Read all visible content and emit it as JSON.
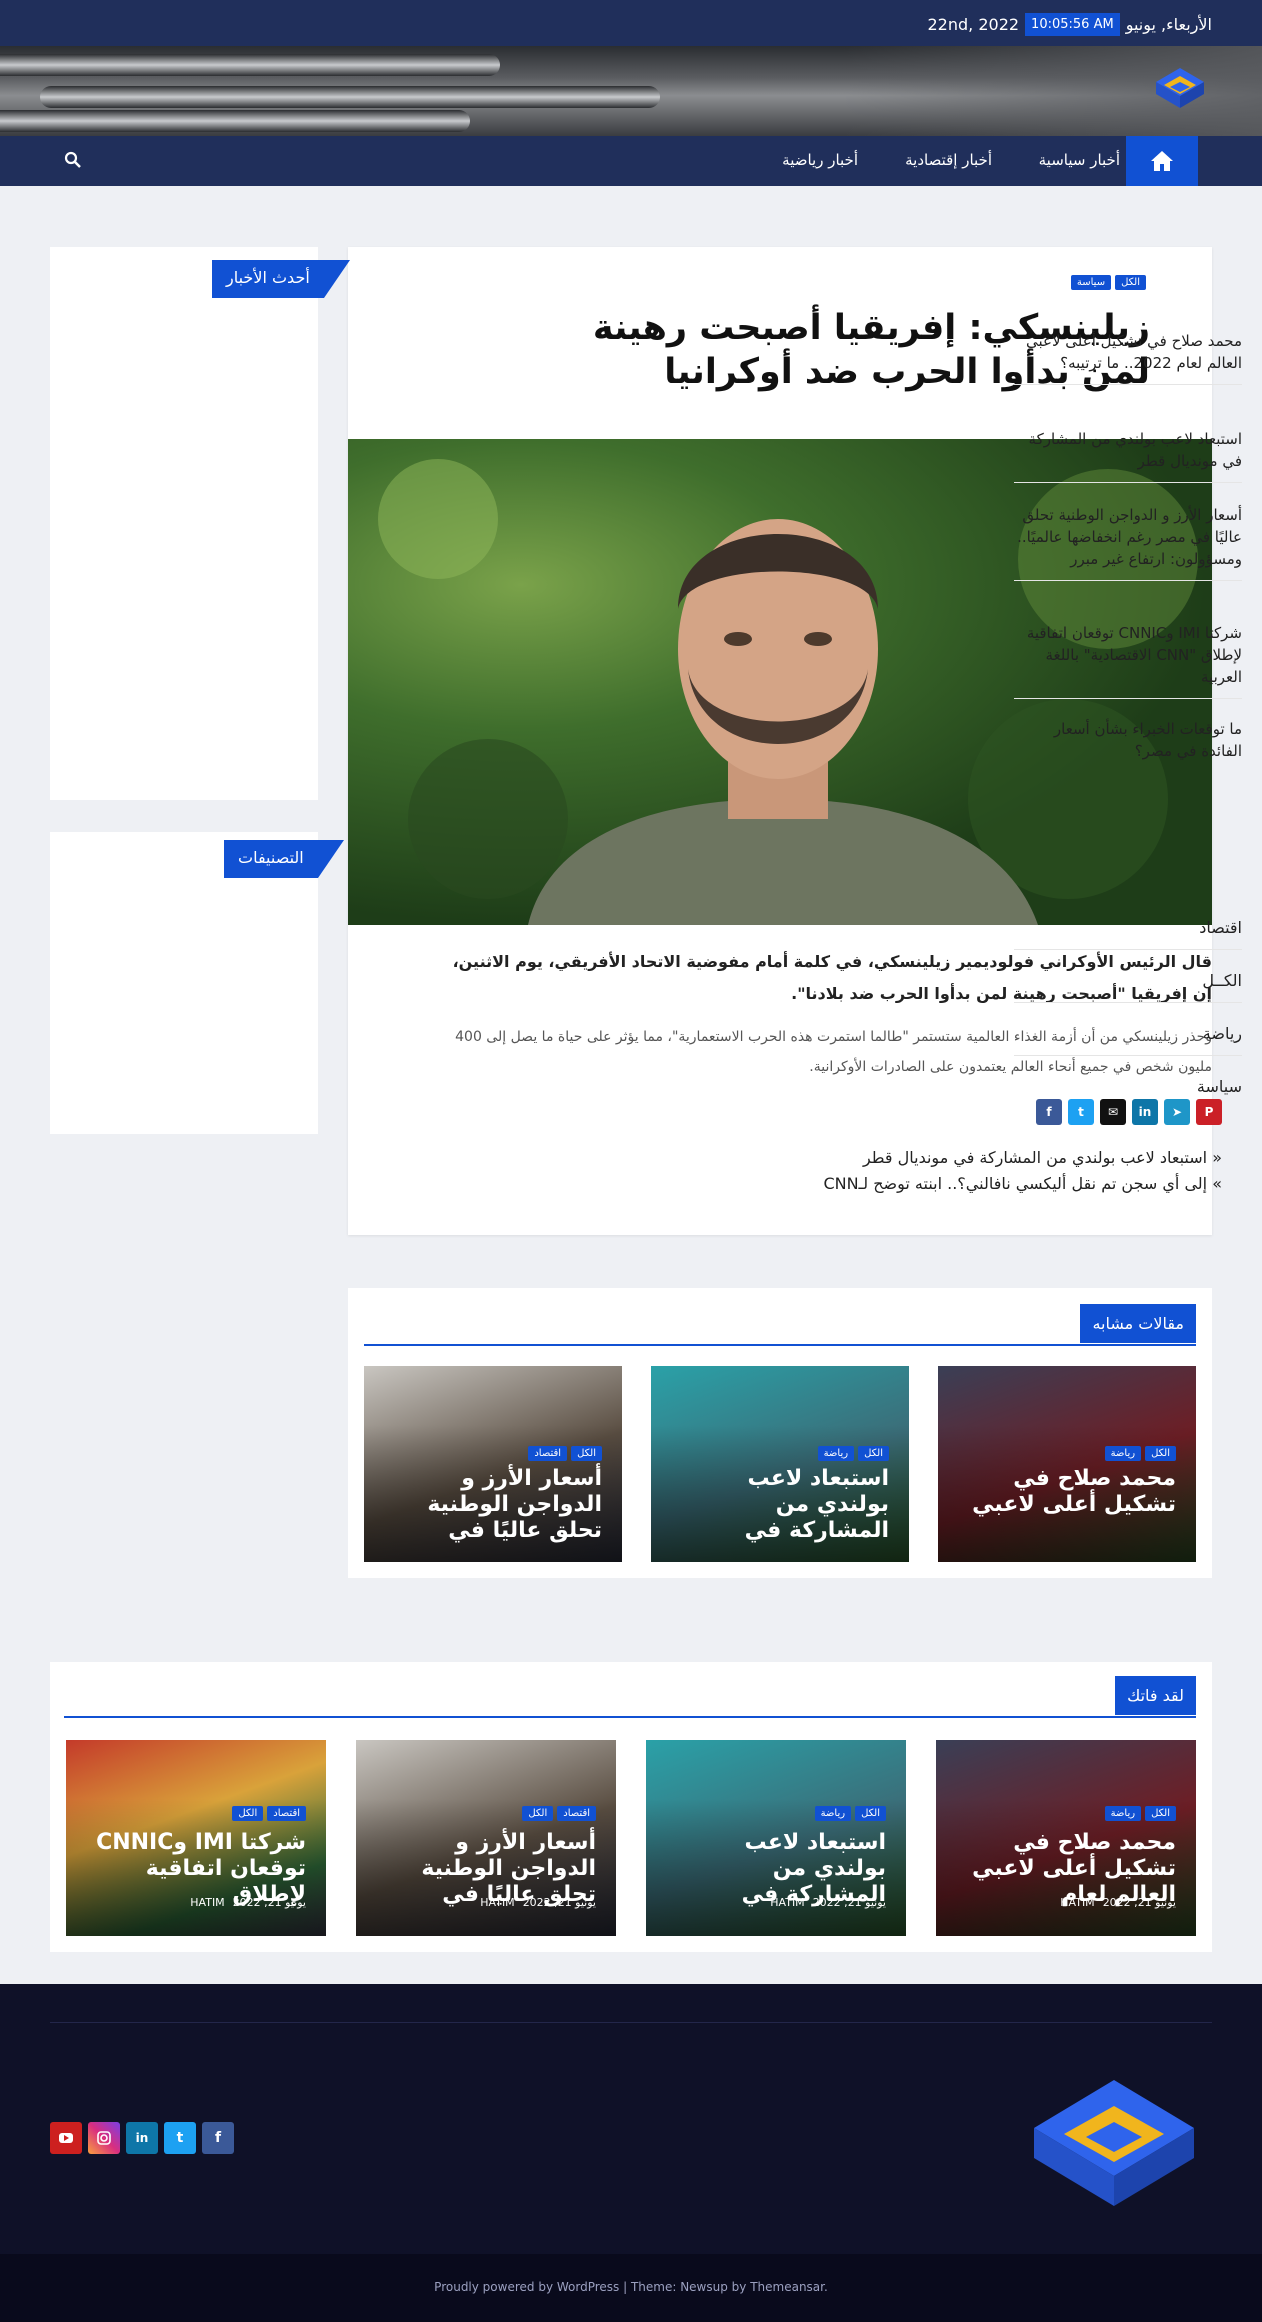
{
  "topbar": {
    "day_label": "الأربعاء, يونيو",
    "time": "10:05:56 AM",
    "date_tail": "22nd, 2022"
  },
  "nav": {
    "items": [
      "أخبار سياسية",
      "أخبار إقتصادية",
      "أخبار رياضية"
    ]
  },
  "article": {
    "categories": [
      "الكل",
      "سياسة"
    ],
    "title": "زيلينسكي: إفريقيا أصبحت رهينة لمن بدأوا الحرب ضد أوكرانيا",
    "lead": "قال الرئيس الأوكراني فولوديمير زيلينسكي، في كلمة أمام مفوضية الاتحاد الأفريقي، يوم الاثنين، إن إفريقيا \"أصبحت رهينة لمن بدأوا الحرب ضد بلادنا\".",
    "body": "وحذر زيلينسكي من أن أزمة الغذاء العالمية ستستمر \"طالما استمرت هذه الحرب الاستعمارية\"، مما يؤثر على حياة ما يصل إلى 400 مليون شخص في جميع أنحاء العالم يعتمدون على الصادرات الأوكرانية.",
    "share_icons": [
      "facebook-icon",
      "twitter-icon",
      "email-icon",
      "linkedin-icon",
      "telegram-icon",
      "pinterest-icon"
    ],
    "prev_post": "استبعاد لاعب بولندي من المشاركة في مونديال قطر",
    "next_post": "إلى أي سجن تم نقل أليكسي نافالني؟.. ابنته توضح لـCNN"
  },
  "sidebar": {
    "latest_title": "أحدث الأخبار",
    "latest": [
      "محمد صلاح في تشكيل أعلى لاعبي العالم لعام 2022.. ما ترتيبه؟",
      "استبعاد لاعب بولندي من المشاركة في مونديال قطر",
      "أسعار الأرز و الدواجن الوطنية تحلق عاليًا في مصر رغم انخفاضها عالميًا.. ومسؤولون: ارتفاع غير مبرر",
      "شركتا IMI وCNNIC توقعان اتفاقية لإطلاق \"CNN الاقتصادية\" باللغة العربية",
      "ما توقعات الخبراء بشأن أسعار الفائدة في مصر؟"
    ],
    "categories_title": "التصنيفات",
    "categories": [
      "اقتصاد",
      "الكــل",
      "رياضة",
      "سياسة"
    ]
  },
  "related": {
    "title": "مقالات مشابه",
    "cards": [
      {
        "title": "محمد صلاح في تشكيل أعلى لاعبي",
        "badges": [
          "الكل",
          "رياضة"
        ]
      },
      {
        "title": "استبعاد لاعب بولندي من المشاركة في",
        "badges": [
          "الكل",
          "رياضة"
        ]
      },
      {
        "title": "أسعار الأرز و الدواجن الوطنية تحلق عاليًا في",
        "badges": [
          "الكل",
          "اقتصاد"
        ]
      }
    ]
  },
  "missed": {
    "title": "لقد فاتك",
    "cards": [
      {
        "title": "محمد صلاح في تشكيل أعلى لاعبي العالم لعام",
        "badges": [
          "الكل",
          "رياضة"
        ],
        "date": "يونيو 21, 2022",
        "author": "HATIM"
      },
      {
        "title": "استبعاد لاعب بولندي من المشاركة في",
        "badges": [
          "الكل",
          "رياضة"
        ],
        "date": "يونيو 21, 2022",
        "author": "HATIM"
      },
      {
        "title": "أسعار الأرز و الدواجن الوطنية تحلق عاليًا في",
        "badges": [
          "اقتصاد",
          "الكل"
        ],
        "date": "يونيو 21, 2022",
        "author": "HATIM"
      },
      {
        "title": "شركتا IMI وCNNIC توقعان اتفاقية لإطلاق",
        "badges": [
          "اقتصاد",
          "الكل"
        ],
        "date": "يونيو 21, 2022",
        "author": "HATIM"
      }
    ]
  },
  "footer": {
    "social_icons": [
      "facebook-icon",
      "twitter-icon",
      "linkedin-icon",
      "instagram-icon",
      "youtube-icon"
    ],
    "credit": "Proudly powered by WordPress | Theme: Newsup by Themeansar."
  },
  "colors": {
    "accent": "#1151d3",
    "nav_bg": "#202f5b",
    "footer_bg": "#0f1128"
  }
}
